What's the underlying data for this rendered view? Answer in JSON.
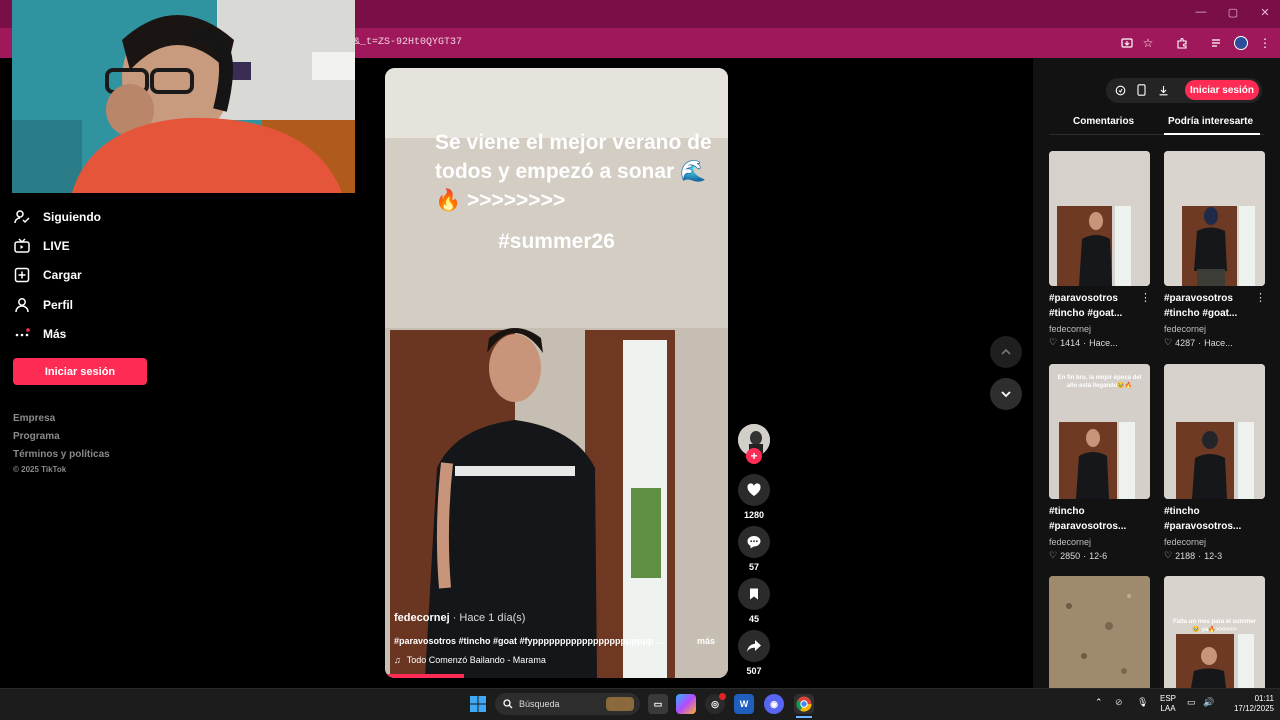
{
  "browser": {
    "url_fragment": "&_t=ZS-92Ht0QYGT37"
  },
  "nav": {
    "items": [
      {
        "label": "Siguiendo",
        "icon": "following-icon"
      },
      {
        "label": "LIVE",
        "icon": "live-icon"
      },
      {
        "label": "Cargar",
        "icon": "upload-icon"
      },
      {
        "label": "Perfil",
        "icon": "profile-icon"
      },
      {
        "label": "Más",
        "icon": "more-icon"
      }
    ],
    "login_label": "Iniciar sesión",
    "footer": [
      "Empresa",
      "Programa",
      "Términos y políticas",
      "© 2025 TikTok"
    ]
  },
  "video": {
    "overlay_caption": "Se viene el mejor verano de todos y empezó a sonar 🌊🔥 >>>>>>>>",
    "overlay_hashtag": "#summer26",
    "author": "fedecornej",
    "time": " · Hace 1 día(s)",
    "description": "#paravosotros #tincho #goat #fypppppppppppppppppppppp ...",
    "more_label": "más",
    "music": "Todo Comenzó Bailando - Marama",
    "progress": 0.23
  },
  "actions": {
    "likes": "1280",
    "comments": "57",
    "saves": "45",
    "shares": "507"
  },
  "right": {
    "login_label": "Iniciar sesión",
    "tabs": [
      "Comentarios",
      "Podría interesarte"
    ],
    "active_tab": "Podría interesarte",
    "cards": [
      {
        "title": "#paravosotros #tincho #goat...",
        "author": "fedecornej",
        "likes": "1414",
        "date": "Hace..."
      },
      {
        "title": "#paravosotros #tincho #goat...",
        "author": "fedecornej",
        "likes": "4287",
        "date": "Hace..."
      },
      {
        "title": "#tincho #paravosotros...",
        "author": "fedecornej",
        "likes": "2850",
        "date": "12-6",
        "thumb_text": "En fin bro, la mejor época del año está llegando🥹🔥"
      },
      {
        "title": "#tincho #paravosotros...",
        "author": "fedecornej",
        "likes": "2188",
        "date": "12-3"
      },
      {
        "title": "",
        "author": "",
        "likes": "",
        "date": ""
      },
      {
        "title": "",
        "author": "",
        "likes": "",
        "date": "",
        "thumb_text": "Falta un mes para el summer🥹 ya🔥>>>>>>"
      }
    ]
  },
  "taskbar": {
    "search_label": "Búsqueda",
    "lang_line1": "ESP",
    "lang_line2": "LAA",
    "time": "01:11",
    "date": "17/12/2025"
  },
  "colors": {
    "accent": "#fe2c55",
    "browser_frame": "#a0185c"
  }
}
